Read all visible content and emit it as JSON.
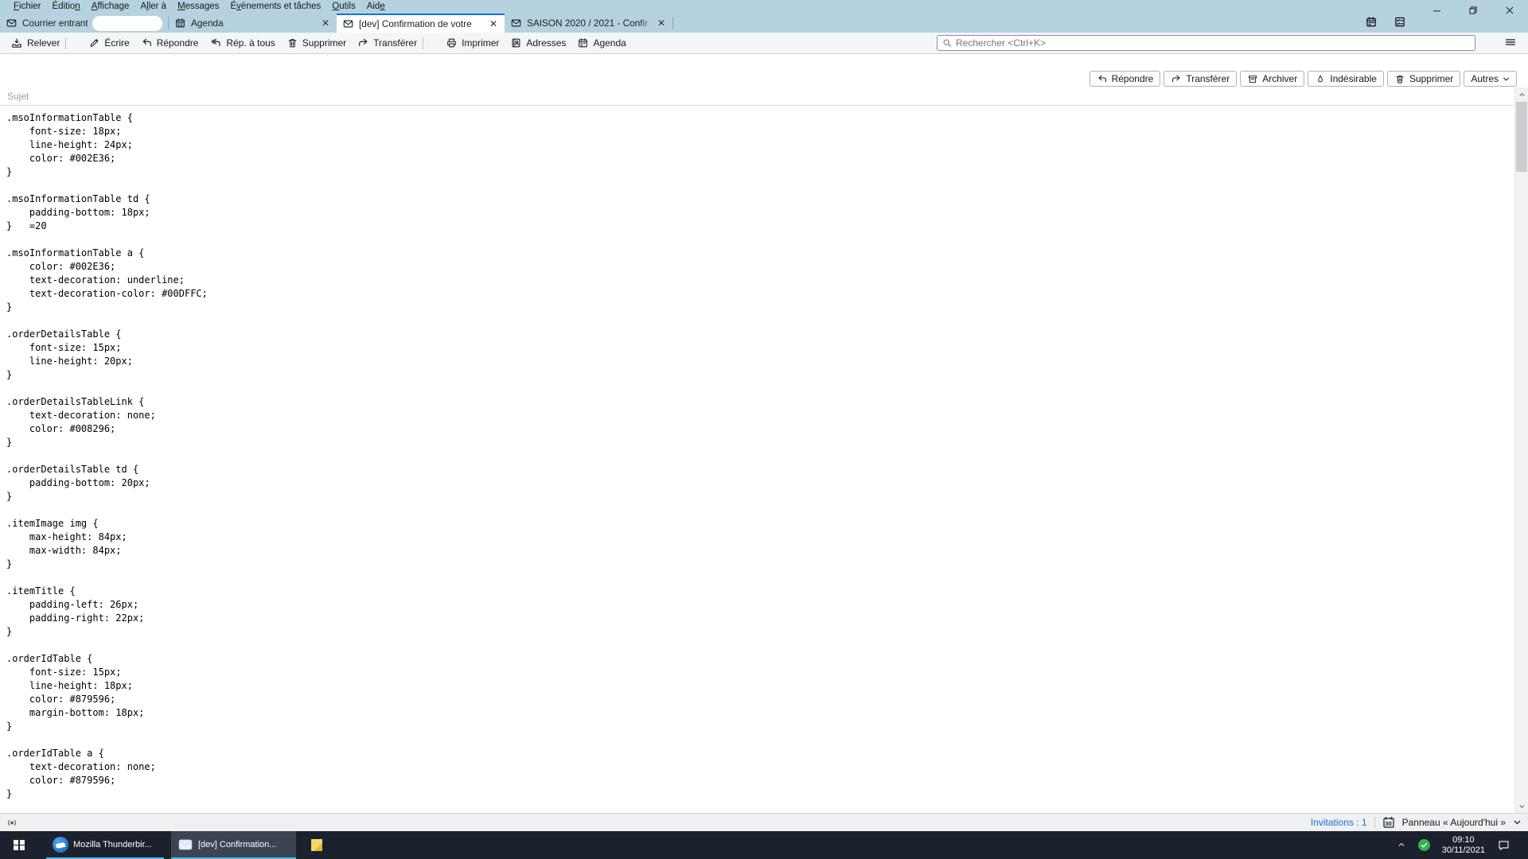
{
  "colors": {
    "topbar_blue": "#b6d2e0",
    "active_tab_accent": "#1573d4",
    "toolbar_gray": "#f4f5f6",
    "invitations_link_blue": "#1a6fd4",
    "taskbar_dark": "#1c212e",
    "taskbar_underline_cyan": "#56b8dc",
    "tray_shield_green": "#35b24a",
    "sticky_note_yellow": "#f2d867"
  },
  "icons": [
    "mail-icon",
    "calendar-icon",
    "envelope-icon",
    "close-icon",
    "get-mail-icon",
    "pencil-icon",
    "reply-icon",
    "reply-all-icon",
    "trash-icon",
    "forward-icon",
    "printer-icon",
    "address-book-icon",
    "search-icon",
    "hamburger-icon",
    "archive-icon",
    "junk-flame-icon",
    "chevron-down-icon",
    "tasks-icon",
    "minimize-icon",
    "restore-icon",
    "broadcast-icon",
    "calendar-day-icon",
    "windows-logo-icon",
    "thunderbird-icon",
    "sticky-note-icon",
    "chevron-up-icon",
    "security-check-icon",
    "action-center-icon"
  ],
  "menubar": {
    "items": [
      {
        "pre": "",
        "key": "F",
        "post": "ichier"
      },
      {
        "pre": "Éditio",
        "key": "n",
        "post": ""
      },
      {
        "pre": "",
        "key": "A",
        "post": "ffichage"
      },
      {
        "pre": "A",
        "key": "l",
        "post": "ler à"
      },
      {
        "pre": "",
        "key": "M",
        "post": "essages"
      },
      {
        "pre": "É",
        "key": "v",
        "post": "ènements et tâches"
      },
      {
        "pre": "",
        "key": "O",
        "post": "utils"
      },
      {
        "pre": "Aid",
        "key": "e",
        "post": ""
      }
    ]
  },
  "tabs": {
    "inbox": {
      "label": "Courrier entrant"
    },
    "agenda": {
      "label": "Agenda"
    },
    "message": {
      "label": "[dev] Confirmation de votre"
    },
    "saison": {
      "label": "SAISON 2020 / 2021 - Confir"
    }
  },
  "toolbar": {
    "relever": "Relever",
    "ecrire": "Écrire",
    "repondre": "Répondre",
    "rep_a_tous": "Rép. à tous",
    "supprimer": "Supprimer",
    "transferer": "Transférer",
    "imprimer": "Imprimer",
    "adresses": "Adresses",
    "agenda": "Agenda",
    "search_placeholder": "Rechercher <Ctrl+K>"
  },
  "message_actions": {
    "repondre": "Répondre",
    "transferer": "Transférer",
    "archiver": "Archiver",
    "indesirable": "Indésirable",
    "supprimer": "Supprimer",
    "autres": "Autres"
  },
  "header": {
    "subject": "Sujet"
  },
  "body": {
    "code": ".msoInformationTable {\n    font-size: 18px;\n    line-height: 24px;\n    color: #002E36;\n}\n\n.msoInformationTable td {\n    padding-bottom: 18px;\n}   =20\n\n.msoInformationTable a {\n    color: #002E36;\n    text-decoration: underline;\n    text-decoration-color: #00DFFC;\n}\n\n.orderDetailsTable {\n    font-size: 15px;\n    line-height: 20px;\n}\n\n.orderDetailsTableLink {\n    text-decoration: none;\n    color: #008296;\n}\n\n.orderDetailsTable td {\n    padding-bottom: 20px;\n}\n\n.itemImage img {\n    max-height: 84px;\n    max-width: 84px;\n}\n\n.itemTitle {\n    padding-left: 26px;\n    padding-right: 22px;\n}\n\n.orderIdTable {\n    font-size: 15px;\n    line-height: 18px;\n    color: #879596;\n    margin-bottom: 18px;\n}\n\n.orderIdTable a {\n    text-decoration: none;\n    color: #879596;\n}"
  },
  "statusbar": {
    "invitations": "Invitations : 1",
    "panel_day": "30",
    "panel": "Panneau « Aujourd'hui »"
  },
  "taskbar": {
    "app1": "Mozilla Thunderbir...",
    "app2": "[dev] Confirmation...",
    "time": "09:10",
    "date": "30/11/2021"
  }
}
